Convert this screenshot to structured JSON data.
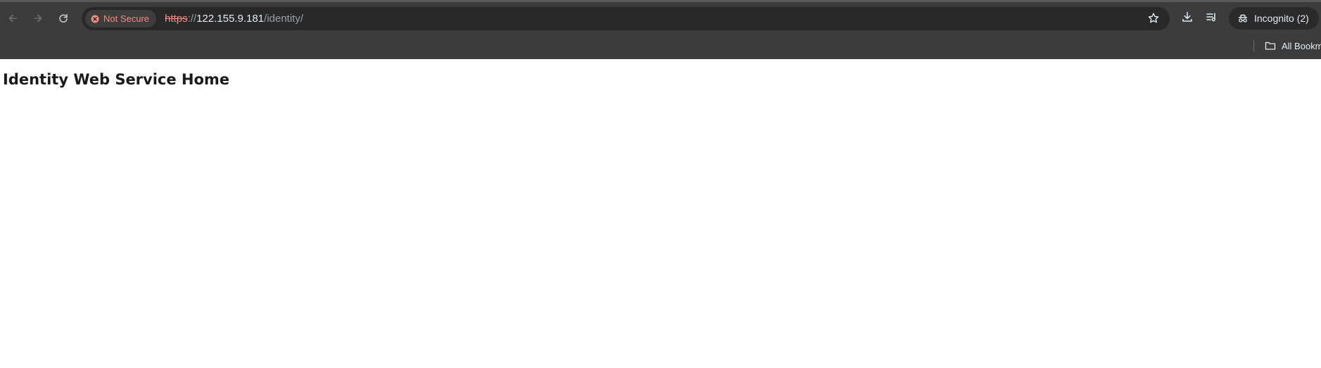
{
  "browser": {
    "nav": {
      "back_icon": "arrow-left-icon",
      "forward_icon": "arrow-right-icon",
      "reload_icon": "reload-icon"
    },
    "security_chip": {
      "label": "Not Secure",
      "icon": "warning-icon",
      "color": "#f28b82"
    },
    "url": {
      "scheme": "https",
      "separator": "://",
      "host": "122.155.9.181",
      "path": "/identity/"
    },
    "toolbar_icons": [
      "star-icon",
      "download-icon",
      "tab-search-icon"
    ],
    "profile": {
      "label": "Incognito (2)",
      "icon": "incognito-icon"
    },
    "bookmarks_bar": {
      "all_bookmarks_label": "All Bookm",
      "icon": "folder-icon"
    }
  },
  "page": {
    "heading": "Identity Web Service Home"
  },
  "colors": {
    "chrome_bg": "#3c3c3c",
    "omnibox_bg": "#282828",
    "page_bg": "#ffffff",
    "warning": "#f28b82"
  }
}
